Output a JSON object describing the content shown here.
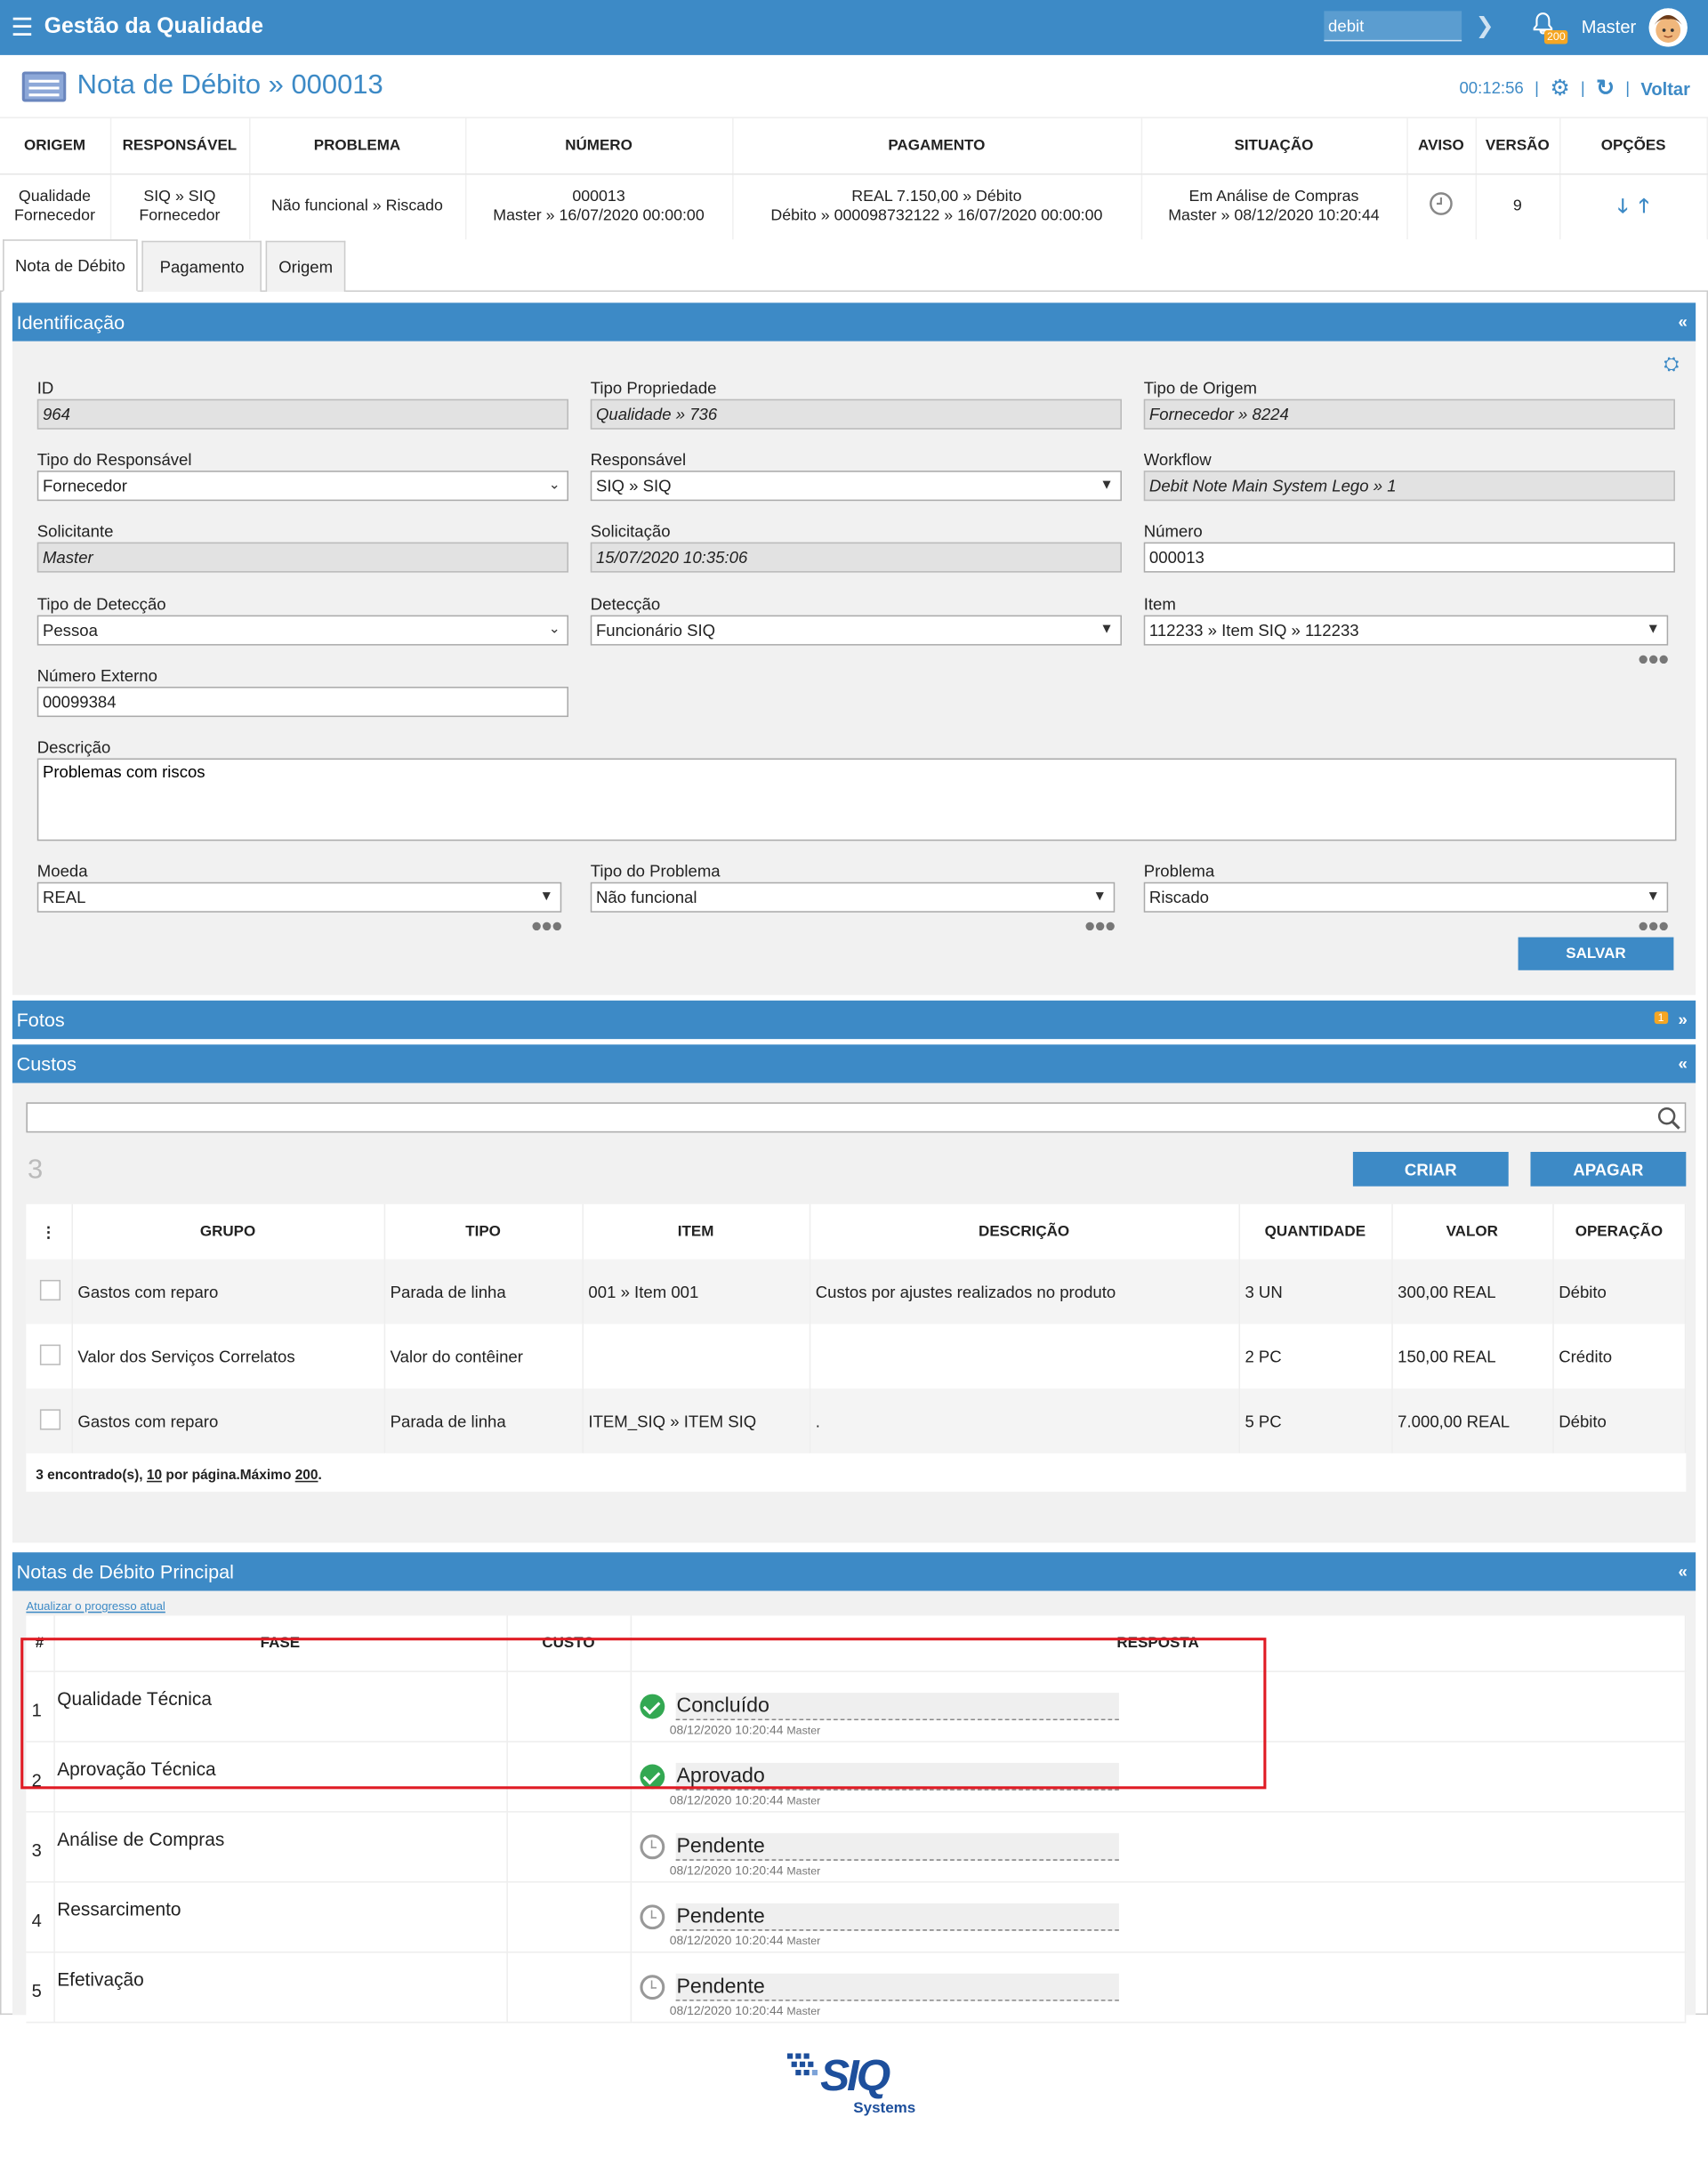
{
  "header": {
    "app_title": "Gestão da Qualidade",
    "search_value": "debit",
    "notification_count": "200",
    "user_name": "Master"
  },
  "page": {
    "title": "Nota de Débito » 000013",
    "timer": "00:12:56",
    "back_label": "Voltar"
  },
  "summary": {
    "headers": [
      "ORIGEM",
      "RESPONSÁVEL",
      "PROBLEMA",
      "NÚMERO",
      "PAGAMENTO",
      "SITUAÇÃO",
      "AVISO",
      "VERSÃO",
      "OPÇÕES"
    ],
    "origem": [
      "Qualidade",
      "Fornecedor"
    ],
    "responsavel": [
      "SIQ » SIQ",
      "Fornecedor"
    ],
    "problema": "Não funcional » Riscado",
    "numero": [
      "000013",
      "Master » 16/07/2020 00:00:00"
    ],
    "pagamento": [
      "REAL 7.150,00 » Débito",
      "Débito » 000098732122 » 16/07/2020 00:00:00"
    ],
    "situacao": [
      "Em Análise de Compras",
      "Master » 08/12/2020 10:20:44"
    ],
    "versao": "9"
  },
  "tabs": [
    "Nota de Débito",
    "Pagamento",
    "Origem"
  ],
  "identificacao": {
    "title": "Identificação",
    "id_label": "ID",
    "id_value": "964",
    "tipo_prop_label": "Tipo Propriedade",
    "tipo_prop_value": "Qualidade » 736",
    "tipo_origem_label": "Tipo de Origem",
    "tipo_origem_value": "Fornecedor » 8224",
    "tipo_resp_label": "Tipo do Responsável",
    "tipo_resp_value": "Fornecedor",
    "responsavel_label": "Responsável",
    "responsavel_value": "SIQ » SIQ",
    "workflow_label": "Workflow",
    "workflow_value": "Debit Note Main System Lego » 1",
    "solicitante_label": "Solicitante",
    "solicitante_value": "Master",
    "solicitacao_label": "Solicitação",
    "solicitacao_value": "15/07/2020 10:35:06",
    "numero_label": "Número",
    "numero_value": "000013",
    "tipo_det_label": "Tipo de Detecção",
    "tipo_det_value": "Pessoa",
    "deteccao_label": "Detecção",
    "deteccao_value": "Funcionário SIQ",
    "item_label": "Item",
    "item_value": "112233 » Item SIQ » 112233",
    "num_ext_label": "Número Externo",
    "num_ext_value": "00099384",
    "descricao_label": "Descrição",
    "descricao_value": "Problemas com riscos",
    "moeda_label": "Moeda",
    "moeda_value": "REAL",
    "tipo_prob_label": "Tipo do Problema",
    "tipo_prob_value": "Não funcional",
    "problema_label": "Problema",
    "problema_value": "Riscado",
    "save_label": "SALVAR"
  },
  "fotos": {
    "title": "Fotos",
    "badge": "1"
  },
  "custos": {
    "title": "Custos",
    "count": "3",
    "create_label": "CRIAR",
    "delete_label": "APAGAR",
    "headers": [
      "GRUPO",
      "TIPO",
      "ITEM",
      "DESCRIÇÃO",
      "QUANTIDADE",
      "VALOR",
      "OPERAÇÃO"
    ],
    "rows": [
      [
        "Gastos com reparo",
        "Parada de linha",
        "001 » Item 001",
        "Custos por ajustes realizados no produto",
        "3 UN",
        "300,00 REAL",
        "Débito"
      ],
      [
        "Valor dos Serviços Correlatos",
        "Valor do contêiner",
        "",
        "",
        "2 PC",
        "150,00 REAL",
        "Crédito"
      ],
      [
        "Gastos com reparo",
        "Parada de linha",
        "ITEM_SIQ » ITEM SIQ",
        ".",
        "5 PC",
        "7.000,00 REAL",
        "Débito"
      ]
    ],
    "footer_found": "3 encontrado(s), ",
    "footer_per_page_num": "10",
    "footer_per_page": " por página.Máximo ",
    "footer_max": "200",
    "footer_end": "."
  },
  "notas": {
    "title": "Notas de Débito Principal",
    "refresh_link": "Atualizar o progresso atual",
    "headers": [
      "#",
      "FASE",
      "CUSTO",
      "RESPOSTA"
    ],
    "rows": [
      {
        "n": "1",
        "fase": "Qualidade Técnica",
        "status": "Concluído",
        "date": "08/12/2020 10:20:44",
        "user": "Master"
      },
      {
        "n": "2",
        "fase": "Aprovação Técnica",
        "status": "Aprovado",
        "date": "08/12/2020 10:20:44",
        "user": "Master"
      },
      {
        "n": "3",
        "fase": "Análise de Compras",
        "status": "Pendente",
        "date": "08/12/2020 10:20:44",
        "user": "Master"
      },
      {
        "n": "4",
        "fase": "Ressarcimento",
        "status": "Pendente",
        "date": "08/12/2020 10:20:44",
        "user": "Master"
      },
      {
        "n": "5",
        "fase": "Efetivação",
        "status": "Pendente",
        "date": "08/12/2020 10:20:44",
        "user": "Master"
      }
    ]
  },
  "footer": {
    "logo_text": "SIQ",
    "logo_sub": "Systems"
  }
}
